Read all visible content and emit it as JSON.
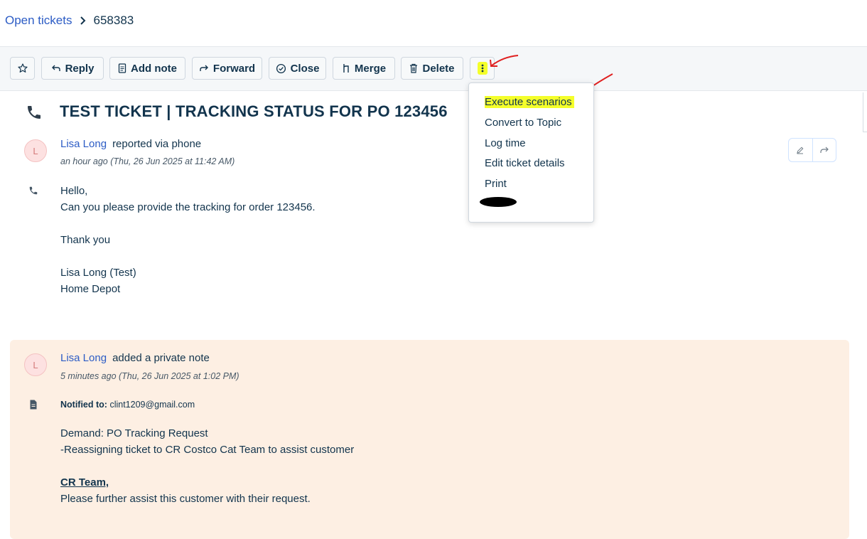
{
  "breadcrumb": {
    "parent": "Open tickets",
    "current": "658383"
  },
  "toolbar": {
    "reply": "Reply",
    "add_note": "Add note",
    "forward": "Forward",
    "close": "Close",
    "merge": "Merge",
    "delete": "Delete"
  },
  "menu": {
    "items": [
      "Execute scenarios",
      "Convert to Topic",
      "Log time",
      "Edit ticket details",
      "Print"
    ]
  },
  "ticket": {
    "title": "TEST TICKET | TRACKING STATUS FOR PO 123456"
  },
  "message": {
    "avatar": "L",
    "author": "Lisa Long",
    "action": "reported via phone",
    "time": "an hour ago (Thu, 26 Jun 2025 at 11:42 AM)",
    "body": "Hello,\nCan you please provide the tracking for order 123456.\n\nThank you\n\nLisa Long (Test)\nHome Depot"
  },
  "note": {
    "avatar": "L",
    "author": "Lisa Long",
    "action": "added a private note",
    "time": "5 minutes ago (Thu, 26 Jun 2025 at 1:02 PM)",
    "notified_label": "Notified to:",
    "notified_value": "clint1209@gmail.com",
    "body": "Demand: PO Tracking Request\n-Reassigning ticket to CR Costco Cat Team to assist customer",
    "team_heading": "CR Team,",
    "team_body": "Please further assist this customer with their request."
  },
  "colors": {
    "link": "#2c5cc5",
    "text": "#12344d",
    "highlight": "#f4ff2a",
    "note_bg": "#fdefe3",
    "annotation": "#e02020"
  }
}
